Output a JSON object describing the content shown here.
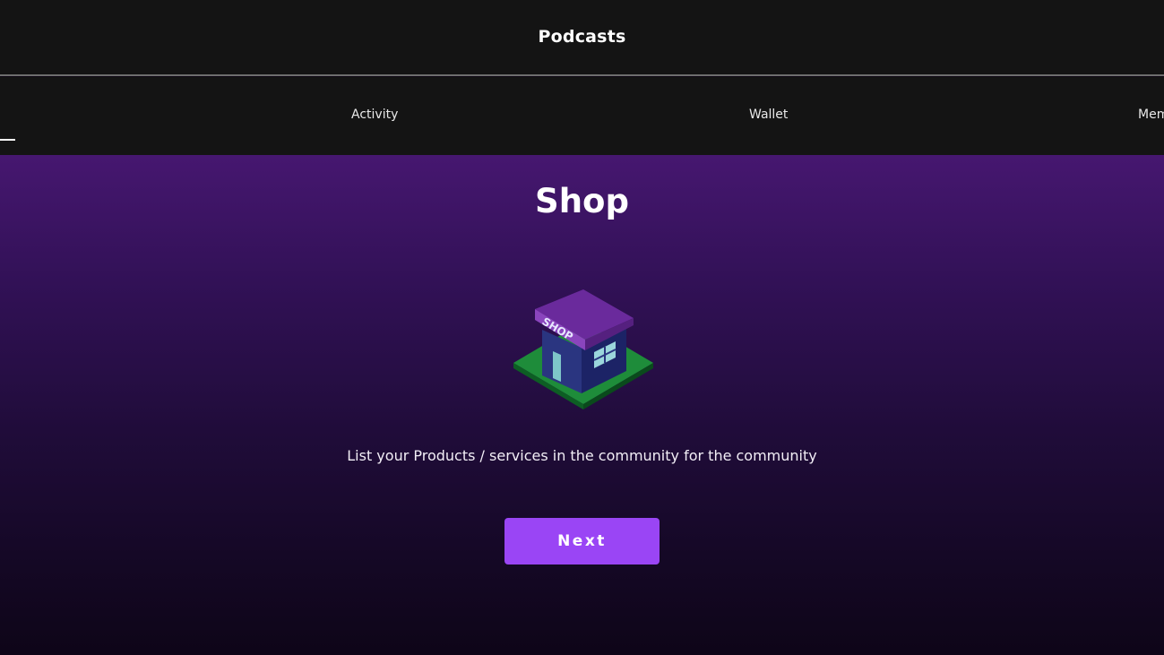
{
  "header": {
    "title": "Podcasts"
  },
  "tabs": [
    {
      "label": "Activity"
    },
    {
      "label": "Wallet"
    },
    {
      "label": "Mem"
    }
  ],
  "main": {
    "title": "Shop",
    "illustration_sign": "SHOP",
    "subtitle": "List your Products / services in the community for the community",
    "next_label": "Next"
  },
  "colors": {
    "background_dark": "#141414",
    "gradient_top": "#461770",
    "gradient_bottom": "#0e0518",
    "button": "#9a45f5"
  }
}
